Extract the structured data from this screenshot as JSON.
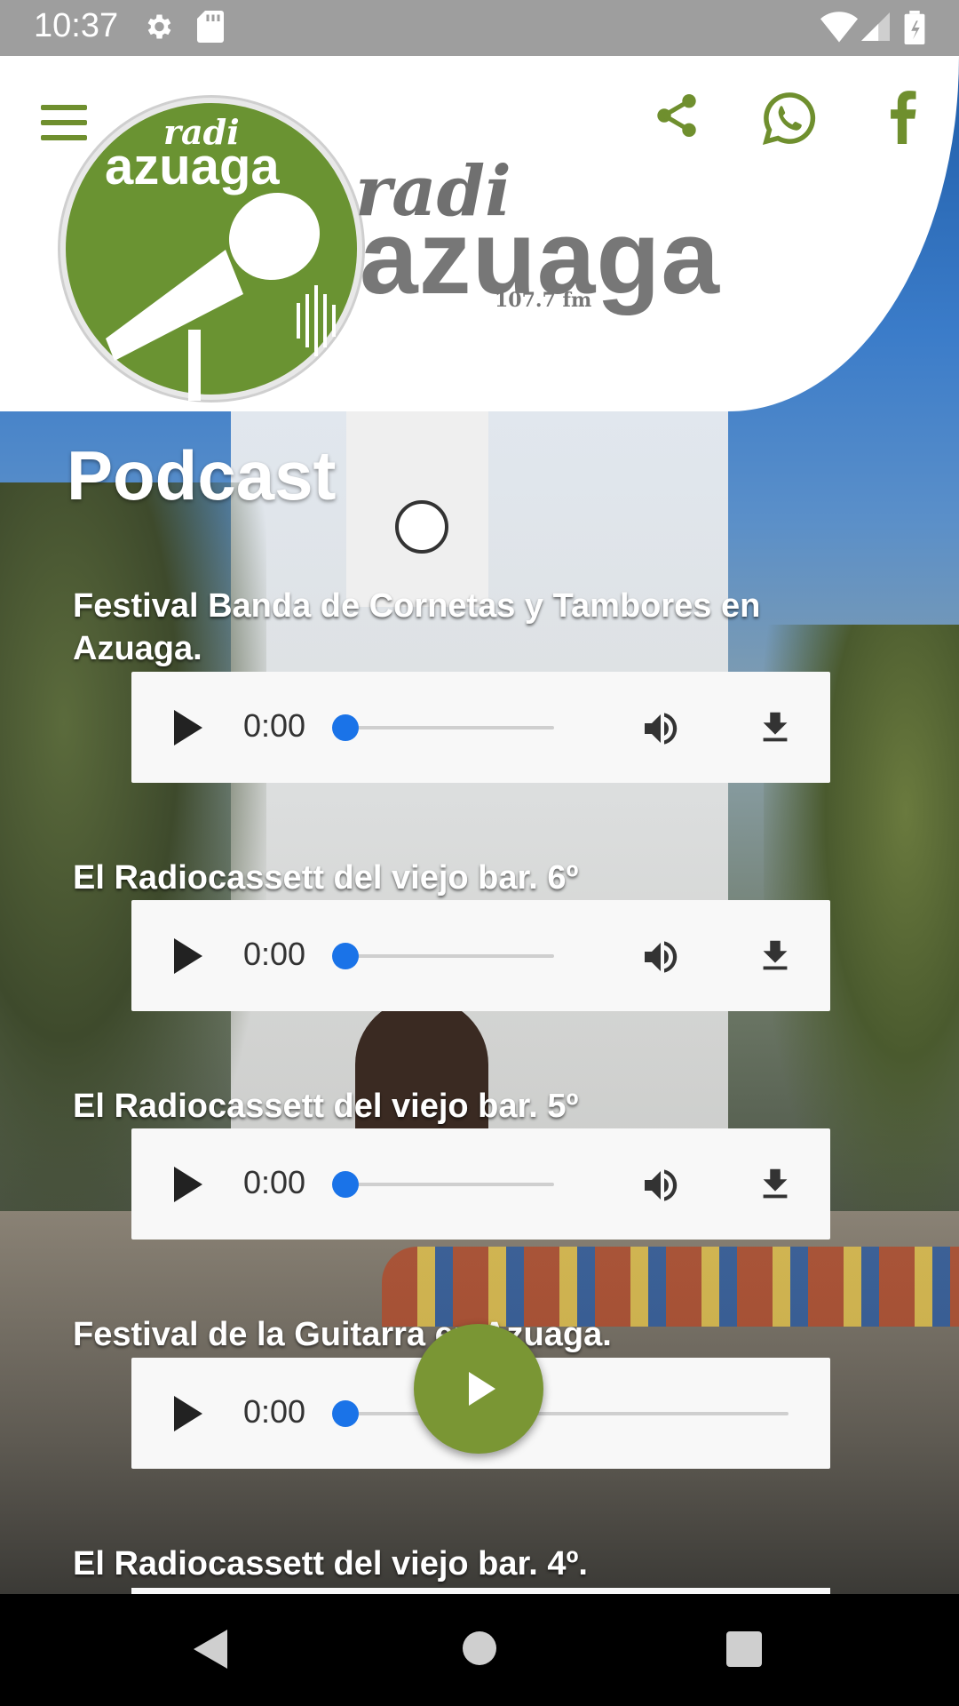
{
  "status_bar": {
    "time": "10:37"
  },
  "header": {
    "logo_badge_top": "radi",
    "logo_badge_main": "azuaga",
    "logo_word_top": "radi",
    "logo_word_main": "azuaga",
    "logo_frequency": "107.7 fm",
    "icons": [
      "menu-icon",
      "share-icon",
      "whatsapp-icon",
      "facebook-icon"
    ]
  },
  "page": {
    "title": "Podcast"
  },
  "episodes": [
    {
      "title": "Festival Banda de Cornetas y Tambores en Azuaga.",
      "time": "0:00"
    },
    {
      "title": "El Radiocassett del viejo bar. 6º",
      "time": "0:00"
    },
    {
      "title": "El Radiocassett del viejo bar. 5º",
      "time": "0:00"
    },
    {
      "title": "Festival de la Guitarra en Azuaga.",
      "time": "0:00"
    },
    {
      "title": "El Radiocassett del viejo bar. 4º."
    }
  ],
  "colors": {
    "brand_green": "#6a9332",
    "player_thumb": "#1a73e8",
    "status_bar": "#9e9e9e"
  }
}
